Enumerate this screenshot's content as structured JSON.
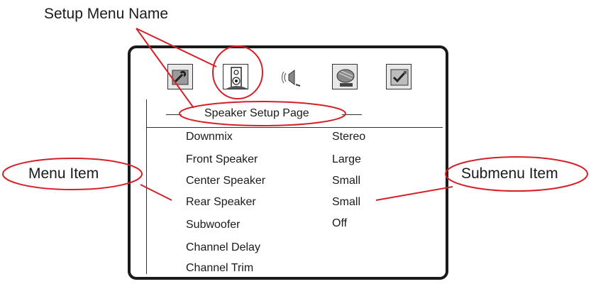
{
  "callouts": {
    "setup_menu_name": "Setup Menu Name",
    "menu_item": "Menu Item",
    "submenu_item": "Submenu Item"
  },
  "colors": {
    "callout_red": "#d62027",
    "frame": "#1a1a1a"
  },
  "toolbar": {
    "icons": [
      {
        "name": "general-setup-icon"
      },
      {
        "name": "speaker-setup-icon",
        "selected": true
      },
      {
        "name": "audio-setup-icon"
      },
      {
        "name": "video-setup-icon"
      },
      {
        "name": "preference-setup-icon"
      }
    ]
  },
  "page": {
    "title": "Speaker Setup Page"
  },
  "menu": {
    "items": [
      {
        "label": "Downmix",
        "value": "Stereo"
      },
      {
        "label": "Front Speaker",
        "value": "Large"
      },
      {
        "label": "Center Speaker",
        "value": "Small"
      },
      {
        "label": "Rear Speaker",
        "value": "Small"
      },
      {
        "label": "Subwoofer",
        "value": "Off"
      },
      {
        "label": "Channel Delay",
        "value": ""
      },
      {
        "label": "Channel Trim",
        "value": ""
      }
    ]
  }
}
